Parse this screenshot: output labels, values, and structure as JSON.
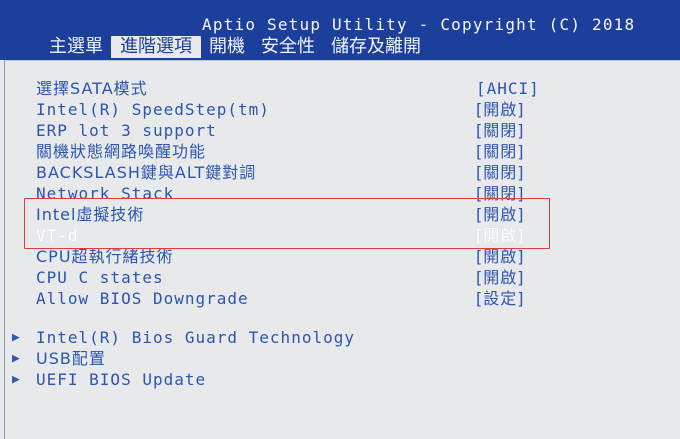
{
  "title": "Aptio Setup Utility - Copyright (C) 2018",
  "tabs": [
    {
      "label": "主選單"
    },
    {
      "label": "進階選項"
    },
    {
      "label": "開機"
    },
    {
      "label": "安全性"
    },
    {
      "label": "儲存及離開"
    }
  ],
  "active_tab": "進階選項",
  "menu": [
    {
      "label": "選擇SATA模式",
      "value": "[AHCI]"
    },
    {
      "label": "Intel(R) SpeedStep(tm)",
      "value": "[開啟]"
    },
    {
      "label": "ERP lot 3 support",
      "value": "[關閉]"
    },
    {
      "label": "關機狀態網路喚醒功能",
      "value": "[關閉]"
    },
    {
      "label": "BACKSLASH鍵與ALT鍵對調",
      "value": "[關閉]"
    },
    {
      "label": "Network Stack",
      "value": "[關閉]"
    },
    {
      "label": "Intel虛擬技術",
      "value": "[開啟]"
    },
    {
      "label": "VT-d",
      "value": "[開啟]"
    },
    {
      "label": "CPU超執行緒技術",
      "value": "[開啟]"
    },
    {
      "label": "CPU C states",
      "value": "[開啟]"
    },
    {
      "label": "Allow BIOS Downgrade",
      "value": "[設定]"
    }
  ],
  "selected_item": "VT-d",
  "submenus": [
    {
      "label": "Intel(R) Bios Guard Technology"
    },
    {
      "label": "USB配置"
    },
    {
      "label": "UEFI BIOS Update"
    }
  ],
  "colors": {
    "header_bg": "#1d3f9c",
    "body_bg": "#e8e9ea",
    "text_blue": "#2c55b0",
    "selected_text": "#ffffff",
    "highlight_box": "#e23b3b"
  }
}
